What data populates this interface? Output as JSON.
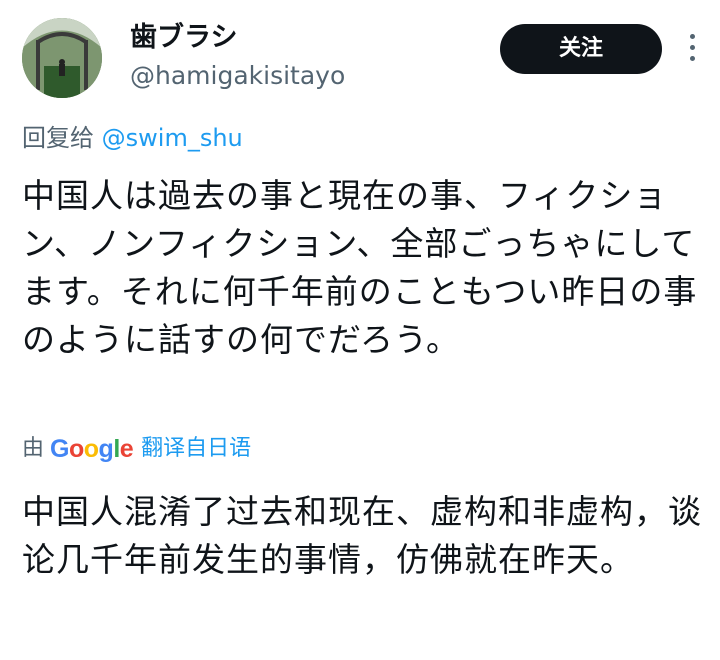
{
  "author": {
    "display_name": "歯ブラシ",
    "handle": "@hamigakisitayo"
  },
  "actions": {
    "follow_label": "关注",
    "more_icon": "more-vertical-icon"
  },
  "reply": {
    "prefix": "回复给",
    "mention": "@swim_shu"
  },
  "tweet": {
    "text": "中国人は過去の事と現在の事、フィクション、ノンフィクション、全部ごっちゃにしてます。それに何千年前のこともつい昨日の事のように話すの何でだろう。"
  },
  "translation": {
    "by": "由",
    "provider": "Google",
    "action_label": "翻译自日语",
    "text": "中国人混淆了过去和现在、虚构和非虚构，谈论几千年前发生的事情，仿佛就在昨天。"
  },
  "colors": {
    "text_primary": "#0f1419",
    "text_secondary": "#536471",
    "link": "#1d9bf0",
    "button_bg": "#0f1419"
  }
}
